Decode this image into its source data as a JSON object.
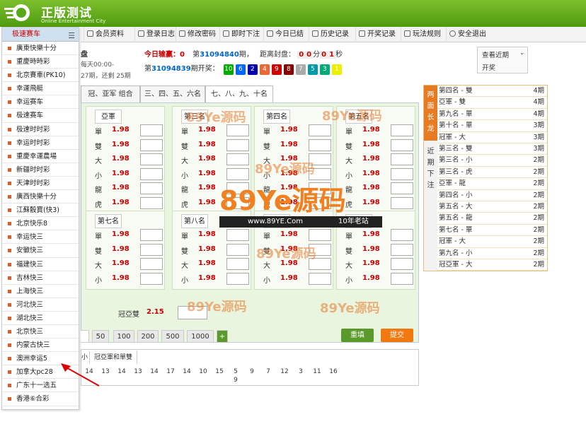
{
  "header": {
    "brand": "正版测试",
    "brand_sub": "Online Entertainment City"
  },
  "nav": {
    "items": [
      "会员资料",
      "登录日志",
      "修改密码",
      "即时下注",
      "今日已结",
      "历史记录",
      "开奖记录",
      "玩法规则",
      "安全退出"
    ]
  },
  "lottery_panel": {
    "title": "极速赛车",
    "items": [
      "廣東快樂十分",
      "重慶時時彩",
      "北京賽車(PK10)",
      "幸運飛艇",
      "幸运赛车",
      "极速赛车",
      "极速时时彩",
      "幸运时时彩",
      "重慶幸運農場",
      "新疆时时彩",
      "天津时时彩",
      "廣西快樂十分",
      "江蘇骰寶(快3)",
      "北京快乐8",
      "幸运快三",
      "安徽快三",
      "福建快三",
      "吉林快三",
      "上海快三",
      "河北快三",
      "湖北快三",
      "北京快三",
      "内蒙古快三",
      "澳洲幸运5",
      "加拿大pc28",
      "广东十一选五",
      "香港⑥合彩"
    ]
  },
  "info": {
    "panel_label": "盘",
    "open_time": "每天00:00-",
    "period_text": "27期，还剩 25期",
    "today_label": "今日输赢：",
    "today_value": "0",
    "period_prefix": "第",
    "current_period": "31094840",
    "period_suffix": "期，",
    "close_label": "距离封盘：",
    "countdown": [
      "0",
      "0",
      "分",
      "0",
      "1",
      "秒"
    ],
    "last_prefix": "第",
    "last_period": "31094839",
    "last_suffix": "期开奖：",
    "draw_numbers": [
      "10",
      "6",
      "2",
      "4",
      "9",
      "8",
      "7",
      "5",
      "3",
      "1"
    ],
    "recent_label": "查看近期",
    "recent_sub": "开奖"
  },
  "tabs": [
    "冠、亚军 组合",
    "三、四、五、六名",
    "七、八、九、十名"
  ],
  "groups": [
    {
      "title": "亞軍",
      "rows": [
        {
          "l": "單",
          "o": "1.98"
        },
        {
          "l": "雙",
          "o": "1.98"
        },
        {
          "l": "大",
          "o": "1.98"
        },
        {
          "l": "小",
          "o": "1.98"
        },
        {
          "l": "龍",
          "o": "1.98"
        },
        {
          "l": "虎",
          "o": "1.98"
        }
      ]
    },
    {
      "title": "第三名",
      "rows": [
        {
          "l": "單",
          "o": "1.98"
        },
        {
          "l": "雙",
          "o": "1.98"
        },
        {
          "l": "大",
          "o": "1.98"
        },
        {
          "l": "小",
          "o": "1.98"
        },
        {
          "l": "龍",
          "o": "1.98"
        },
        {
          "l": "虎",
          "o": "1.98"
        }
      ]
    },
    {
      "title": "第四名",
      "rows": [
        {
          "l": "單",
          "o": "1.98"
        },
        {
          "l": "雙",
          "o": "1.98"
        },
        {
          "l": "大",
          "o": "1.98"
        },
        {
          "l": "小",
          "o": "1.98"
        },
        {
          "l": "龍",
          "o": "1.98"
        },
        {
          "l": "虎",
          "o": "1.98"
        }
      ]
    },
    {
      "title": "第五名",
      "rows": [
        {
          "l": "單",
          "o": "1.98"
        },
        {
          "l": "雙",
          "o": "1.98"
        },
        {
          "l": "大",
          "o": "1.98"
        },
        {
          "l": "小",
          "o": "1.98"
        },
        {
          "l": "龍",
          "o": "1.98"
        },
        {
          "l": "虎",
          "o": "1.98"
        }
      ]
    },
    {
      "title": "第七名",
      "rows": [
        {
          "l": "單",
          "o": "1.98"
        },
        {
          "l": "雙",
          "o": "1.98"
        },
        {
          "l": "大",
          "o": "1.98"
        },
        {
          "l": "小",
          "o": "1.98"
        }
      ]
    },
    {
      "title": "第八名",
      "rows": [
        {
          "l": "單",
          "o": "1.98"
        },
        {
          "l": "雙",
          "o": "1.98"
        },
        {
          "l": "大",
          "o": "1.98"
        },
        {
          "l": "小",
          "o": "1.98"
        }
      ]
    },
    {
      "title": "",
      "rows": [
        {
          "l": "單",
          "o": "1.98"
        },
        {
          "l": "雙",
          "o": "1.98"
        },
        {
          "l": "大",
          "o": "1.98"
        },
        {
          "l": "小",
          "o": "1.98"
        }
      ]
    },
    {
      "title": "",
      "rows": [
        {
          "l": "單",
          "o": "1.98"
        },
        {
          "l": "雙",
          "o": "1.98"
        },
        {
          "l": "大",
          "o": "1.98"
        },
        {
          "l": "小",
          "o": "1.98"
        }
      ]
    }
  ],
  "sum_row": {
    "label": "冠亞雙",
    "odds": "2.15"
  },
  "chips": [
    "50",
    "100",
    "200",
    "500",
    "1000",
    "+"
  ],
  "buttons": {
    "reset": "重填",
    "submit": "提交"
  },
  "bottom": {
    "tab_small": "小",
    "tab_label": "冠亞軍和單雙",
    "numbers": [
      "14",
      "13",
      "14",
      "13",
      "14",
      "17",
      "14",
      "10",
      "15",
      "5",
      "9",
      "7",
      "12",
      "3",
      "11",
      "16"
    ],
    "extra": "9"
  },
  "side": {
    "title_a": "两面长龙",
    "title_b": "近期下注",
    "streaks": [
      {
        "t": "第四名 - 雙",
        "n": "4期",
        "c": "#e06000"
      },
      {
        "t": "亞軍 - 雙",
        "n": "4期",
        "c": "#e06000"
      },
      {
        "t": "第九名 - 單",
        "n": "4期",
        "c": "#e06000"
      },
      {
        "t": "第十名 - 單",
        "n": "3期",
        "c": "#e06000"
      },
      {
        "t": "冠軍 - 大",
        "n": "3期",
        "c": "#e06000"
      },
      {
        "t": "第三名 - 雙",
        "n": "3期",
        "c": "#e06000"
      },
      {
        "t": "第三名 - 小",
        "n": "2期",
        "c": "#e06000"
      },
      {
        "t": "第三名 - 虎",
        "n": "2期",
        "c": "#e06000"
      },
      {
        "t": "亞軍 - 龍",
        "n": "2期",
        "c": "#e06000"
      },
      {
        "t": "第四名 - 小",
        "n": "2期",
        "c": "#e06000"
      },
      {
        "t": "第五名 - 大",
        "n": "2期",
        "c": "#e06000"
      },
      {
        "t": "第五名 - 龍",
        "n": "2期",
        "c": "#e06000"
      },
      {
        "t": "第七名 - 單",
        "n": "2期",
        "c": "#e06000"
      },
      {
        "t": "冠軍 - 大",
        "n": "2期",
        "c": "#e06000"
      },
      {
        "t": "第九名 - 小",
        "n": "2期",
        "c": "#e06000"
      },
      {
        "t": "冠亞軍 - 大",
        "n": "2期",
        "c": "#e06000"
      }
    ]
  },
  "watermark": {
    "big": "89Ye源码",
    "url": "www.89YE.Com",
    "tag": "10年老站"
  }
}
